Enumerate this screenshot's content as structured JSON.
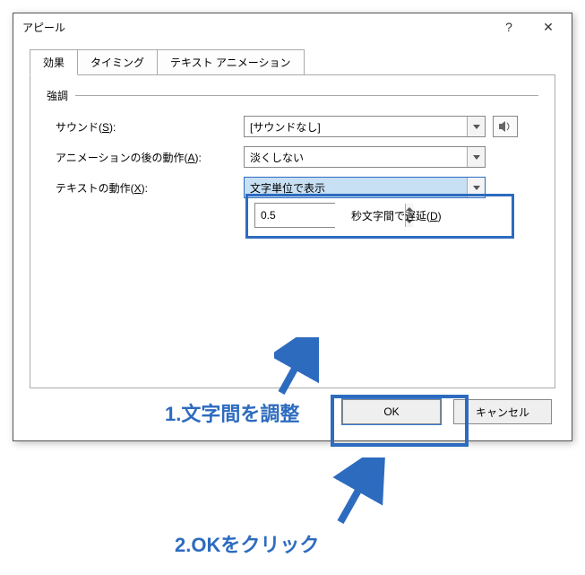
{
  "dialog": {
    "title": "アピール",
    "help": "?",
    "close": "✕"
  },
  "tabs": {
    "effect": "効果",
    "timing": "タイミング",
    "text_anim": "テキスト アニメーション"
  },
  "group": {
    "emphasis": "強調"
  },
  "labels": {
    "sound_pre": "サウンド(",
    "sound_u": "S",
    "sound_post": "):",
    "after_pre": "アニメーションの後の動作(",
    "after_u": "A",
    "after_post": "):",
    "text_pre": "テキストの動作(",
    "text_u": "X",
    "text_post": "):",
    "delay_pre": "秒文字間で遅延(",
    "delay_u": "D",
    "delay_post": ")"
  },
  "values": {
    "sound": "[サウンドなし]",
    "after": "淡くしない",
    "text": "文字単位で表示",
    "delay": "0.5"
  },
  "buttons": {
    "ok": "OK",
    "cancel": "キャンセル"
  },
  "annotations": {
    "a1": "1.文字間を調整",
    "a2": "2.OKをクリック"
  }
}
